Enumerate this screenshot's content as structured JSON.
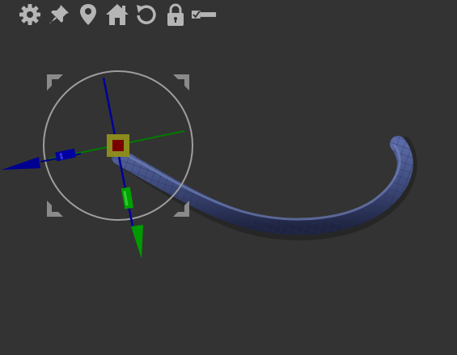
{
  "toolbar": {
    "items": [
      {
        "icon": "gear-icon",
        "name": "settings"
      },
      {
        "icon": "pin-icon",
        "name": "pin"
      },
      {
        "icon": "location-pin-icon",
        "name": "pivot-location"
      },
      {
        "icon": "home-icon",
        "name": "home"
      },
      {
        "icon": "reset-icon",
        "name": "reset"
      },
      {
        "icon": "lock-icon",
        "name": "lock"
      },
      {
        "icon": "checkbox-toggle-icon",
        "name": "toggle"
      }
    ]
  },
  "colors": {
    "background": "#333333",
    "icon": "#b5b5b5",
    "model": "#44507e",
    "axis_x": "#006f00",
    "axis_y": "#000088",
    "axis_z": "#00a000",
    "center_outer": "#8b8b1e",
    "center_inner": "#7a0000",
    "ring": "#9e9e9e"
  }
}
